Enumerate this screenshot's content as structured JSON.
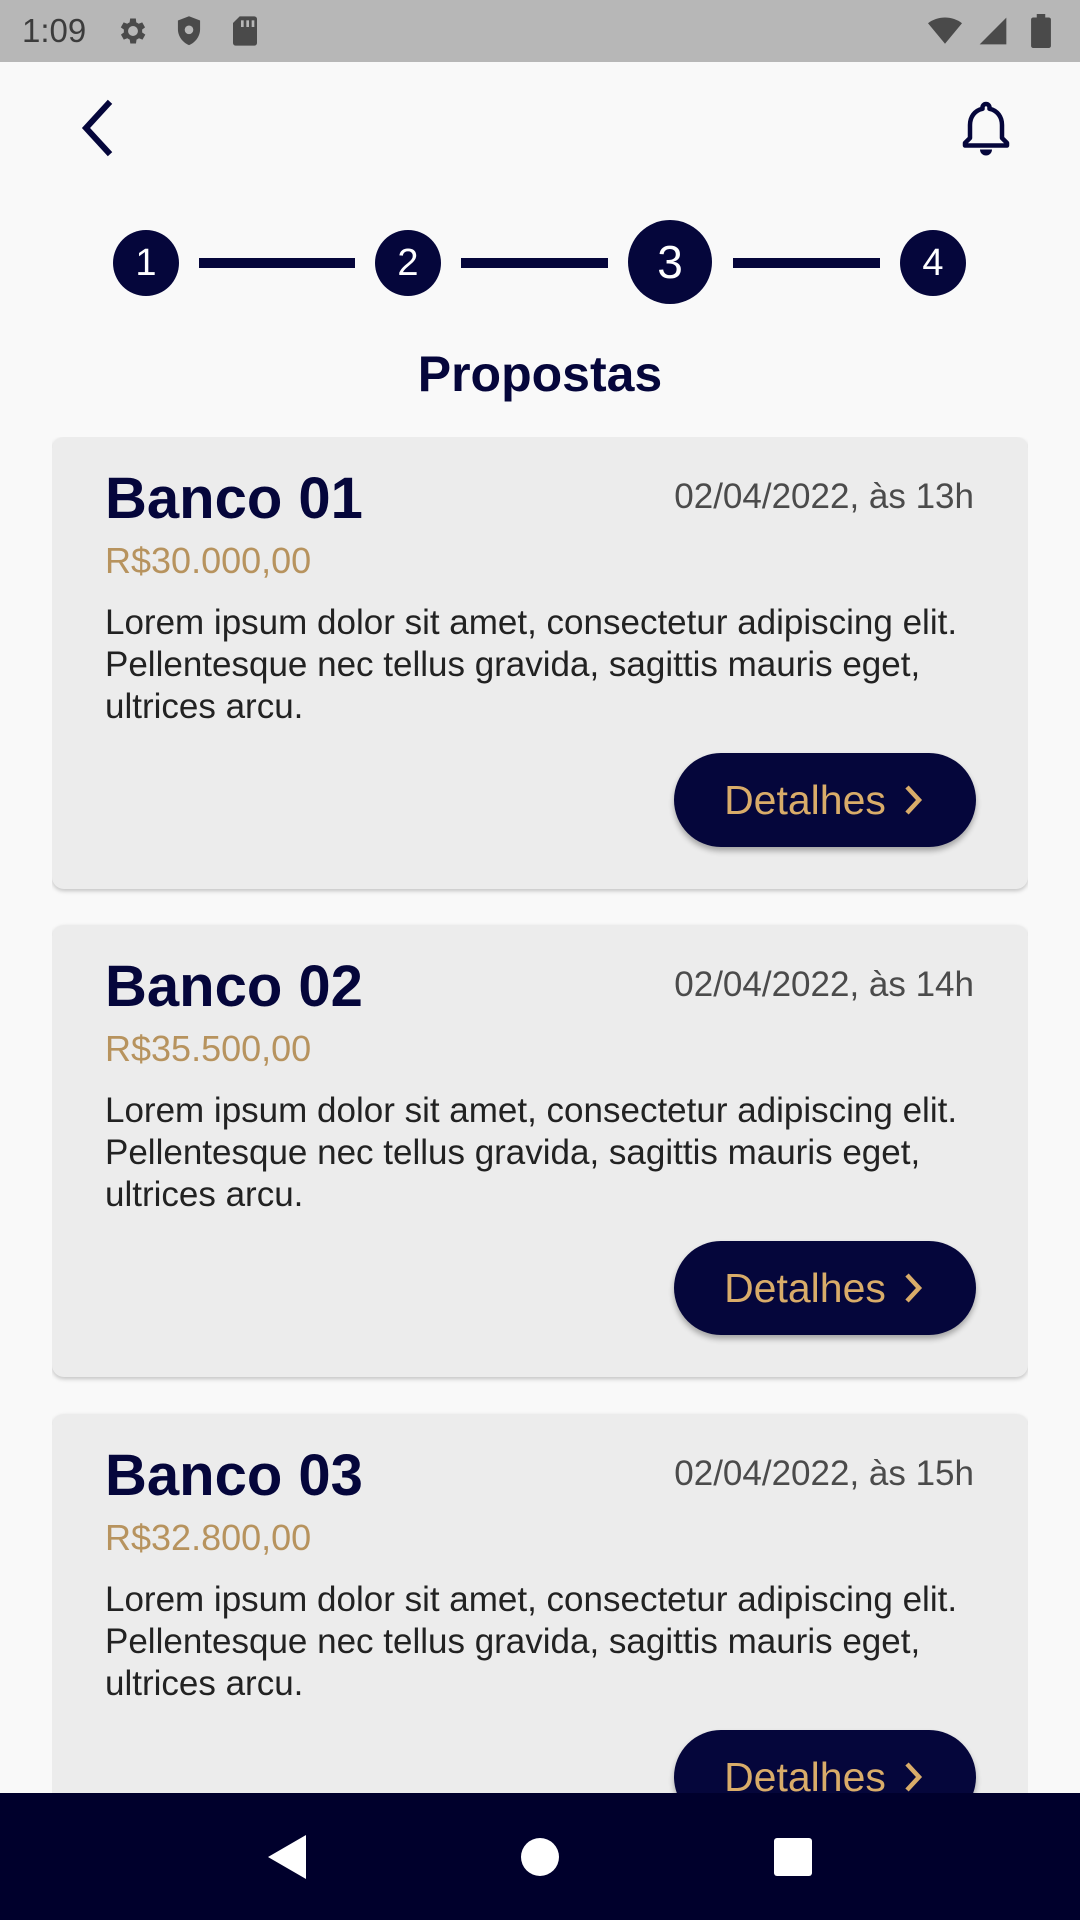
{
  "status_bar": {
    "time": "1:09",
    "icons": [
      "settings-icon",
      "shield-icon",
      "sd-card-icon",
      "wifi-icon",
      "signal-icon",
      "battery-icon"
    ]
  },
  "app_bar": {
    "back_icon": "chevron-left-icon",
    "notifications_icon": "bell-icon"
  },
  "stepper": {
    "steps": [
      "1",
      "2",
      "3",
      "4"
    ],
    "current_step": 3
  },
  "page": {
    "title": "Propostas"
  },
  "proposals": [
    {
      "bank": "Banco 01",
      "date": "02/04/2022, às 13h",
      "amount": "R$30.000,00",
      "description": "Lorem ipsum dolor sit amet, consectetur adipiscing elit. Pellentesque nec tellus gravida, sagittis mauris eget, ultrices arcu.",
      "button_label": "Detalhes"
    },
    {
      "bank": "Banco 02",
      "date": "02/04/2022, às 14h",
      "amount": "R$35.500,00",
      "description": "Lorem ipsum dolor sit amet, consectetur adipiscing elit. Pellentesque nec tellus gravida, sagittis mauris eget, ultrices arcu.",
      "button_label": "Detalhes"
    },
    {
      "bank": "Banco 03",
      "date": "02/04/2022, às 15h",
      "amount": "R$32.800,00",
      "description": "Lorem ipsum dolor sit amet, consectetur adipiscing elit. Pellentesque nec tellus gravida, sagittis mauris eget, ultrices arcu.",
      "button_label": "Detalhes"
    }
  ],
  "nav_bar": {
    "icons": [
      "back-triangle-icon",
      "home-circle-icon",
      "recents-square-icon"
    ]
  },
  "colors": {
    "primary": "#05063b",
    "accent": "#d9ac69",
    "amount": "#b7935e",
    "card_background": "#ececec",
    "nav_bar": "#00002c"
  }
}
